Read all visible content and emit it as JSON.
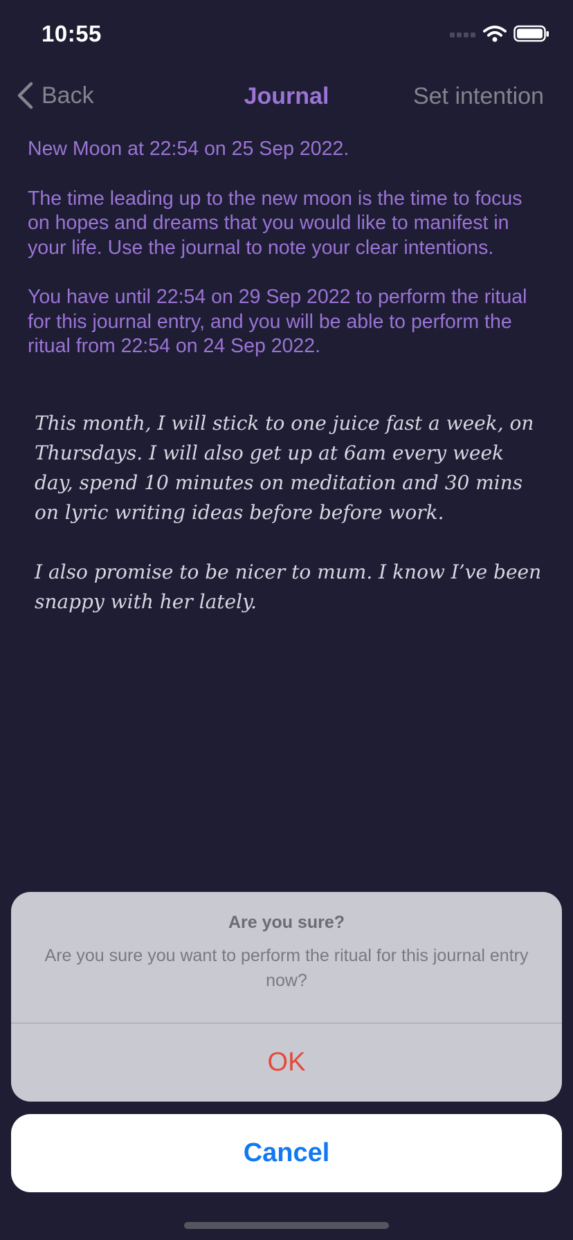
{
  "status_bar": {
    "time": "10:55"
  },
  "nav": {
    "back_label": "Back",
    "title": "Journal",
    "right_label": "Set intention"
  },
  "info": {
    "moon_line": "New Moon at 22:54 on 25 Sep 2022.",
    "guidance": "The time leading up to the new moon is the time to focus on hopes and dreams that you would like to manifest in your life. Use the journal to note your clear intentions.",
    "ritual_window": "You have until 22:54 on 29 Sep 2022 to perform the ritual for this journal entry, and you will be able to perform the ritual from 22:54 on 24 Sep 2022."
  },
  "entry": {
    "paragraph_1": "This month, I will stick to one juice fast a week, on Thursdays. I will also get up at 6am every week day, spend 10 minutes on meditation and 30 mins on lyric writing ideas before before work.",
    "paragraph_2": "I also promise to be nicer to mum. I know I’ve been snappy with her lately."
  },
  "alert": {
    "title": "Are you sure?",
    "message": "Are you sure you want to perform the ritual for this journal entry now?",
    "ok_label": "OK",
    "cancel_label": "Cancel"
  },
  "colors": {
    "background": "#1e1d33",
    "accent_purple": "#9b74d6",
    "destructive_red": "#e5493a",
    "cancel_blue": "#1279f0"
  },
  "icons": {
    "back": "chevron-left-icon",
    "signal": "cellular-signal-icon",
    "wifi": "wifi-icon",
    "battery": "battery-icon"
  }
}
